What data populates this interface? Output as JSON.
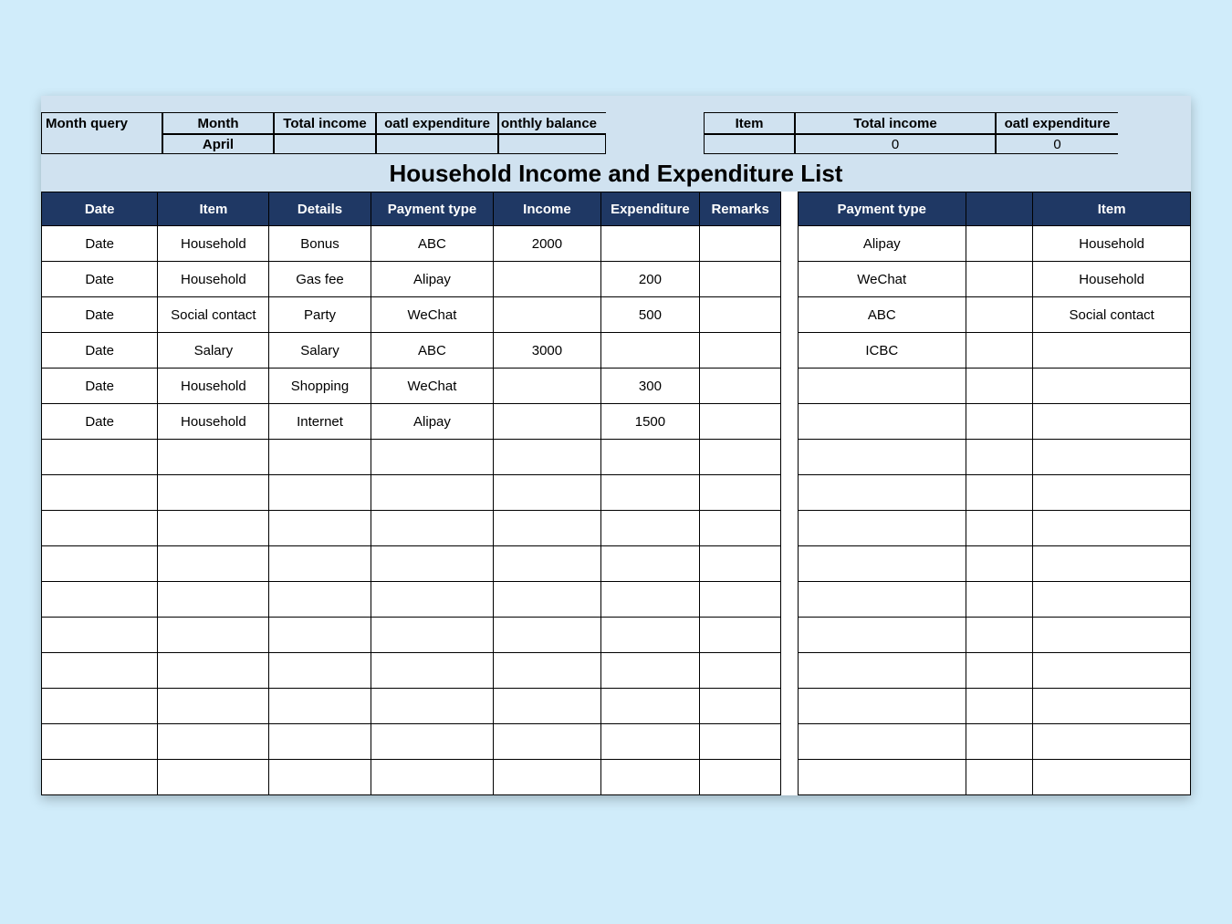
{
  "query": {
    "label": "Month query",
    "month_header": "Month",
    "total_income_header": "Total income",
    "total_exp_header": "oatl expenditure",
    "balance_header": "onthly balance",
    "month_value": "April",
    "total_income_value": "",
    "total_exp_value": "",
    "balance_value": "",
    "item_header": "Item",
    "sum_income_header": "Total income",
    "sum_exp_header": "oatl expenditure",
    "item_value": "",
    "sum_income_value": "0",
    "sum_exp_value": "0"
  },
  "title": "Household Income and Expenditure List",
  "main_headers": {
    "date": "Date",
    "item": "Item",
    "details": "Details",
    "payment_type": "Payment type",
    "income": "Income",
    "expenditure": "Expenditure",
    "remarks": "Remarks"
  },
  "main_rows": [
    {
      "date": "Date",
      "item": "Household",
      "details": "Bonus",
      "ptype": "ABC",
      "income": "2000",
      "exp": "",
      "remarks": ""
    },
    {
      "date": "Date",
      "item": "Household",
      "details": "Gas fee",
      "ptype": "Alipay",
      "income": "",
      "exp": "200",
      "remarks": ""
    },
    {
      "date": "Date",
      "item": "Social contact",
      "details": "Party",
      "ptype": "WeChat",
      "income": "",
      "exp": "500",
      "remarks": ""
    },
    {
      "date": "Date",
      "item": "Salary",
      "details": "Salary",
      "ptype": "ABC",
      "income": "3000",
      "exp": "",
      "remarks": ""
    },
    {
      "date": "Date",
      "item": "Household",
      "details": "Shopping",
      "ptype": "WeChat",
      "income": "",
      "exp": "300",
      "remarks": ""
    },
    {
      "date": "Date",
      "item": "Household",
      "details": "Internet",
      "ptype": "Alipay",
      "income": "",
      "exp": "1500",
      "remarks": ""
    },
    {
      "date": "",
      "item": "",
      "details": "",
      "ptype": "",
      "income": "",
      "exp": "",
      "remarks": ""
    },
    {
      "date": "",
      "item": "",
      "details": "",
      "ptype": "",
      "income": "",
      "exp": "",
      "remarks": ""
    },
    {
      "date": "",
      "item": "",
      "details": "",
      "ptype": "",
      "income": "",
      "exp": "",
      "remarks": ""
    },
    {
      "date": "",
      "item": "",
      "details": "",
      "ptype": "",
      "income": "",
      "exp": "",
      "remarks": ""
    },
    {
      "date": "",
      "item": "",
      "details": "",
      "ptype": "",
      "income": "",
      "exp": "",
      "remarks": ""
    },
    {
      "date": "",
      "item": "",
      "details": "",
      "ptype": "",
      "income": "",
      "exp": "",
      "remarks": ""
    },
    {
      "date": "",
      "item": "",
      "details": "",
      "ptype": "",
      "income": "",
      "exp": "",
      "remarks": ""
    },
    {
      "date": "",
      "item": "",
      "details": "",
      "ptype": "",
      "income": "",
      "exp": "",
      "remarks": ""
    },
    {
      "date": "",
      "item": "",
      "details": "",
      "ptype": "",
      "income": "",
      "exp": "",
      "remarks": ""
    },
    {
      "date": "",
      "item": "",
      "details": "",
      "ptype": "",
      "income": "",
      "exp": "",
      "remarks": ""
    }
  ],
  "side_headers": {
    "payment_type": "Payment type",
    "blank": "",
    "item": "Item"
  },
  "side_rows": [
    {
      "ptype": "Alipay",
      "blank": "",
      "item": "Household"
    },
    {
      "ptype": "WeChat",
      "blank": "",
      "item": "Household"
    },
    {
      "ptype": "ABC",
      "blank": "",
      "item": "Social contact"
    },
    {
      "ptype": "ICBC",
      "blank": "",
      "item": ""
    },
    {
      "ptype": "",
      "blank": "",
      "item": ""
    },
    {
      "ptype": "",
      "blank": "",
      "item": ""
    },
    {
      "ptype": "",
      "blank": "",
      "item": ""
    },
    {
      "ptype": "",
      "blank": "",
      "item": ""
    },
    {
      "ptype": "",
      "blank": "",
      "item": ""
    },
    {
      "ptype": "",
      "blank": "",
      "item": ""
    },
    {
      "ptype": "",
      "blank": "",
      "item": ""
    },
    {
      "ptype": "",
      "blank": "",
      "item": ""
    },
    {
      "ptype": "",
      "blank": "",
      "item": ""
    },
    {
      "ptype": "",
      "blank": "",
      "item": ""
    },
    {
      "ptype": "",
      "blank": "",
      "item": ""
    },
    {
      "ptype": "",
      "blank": "",
      "item": ""
    }
  ]
}
